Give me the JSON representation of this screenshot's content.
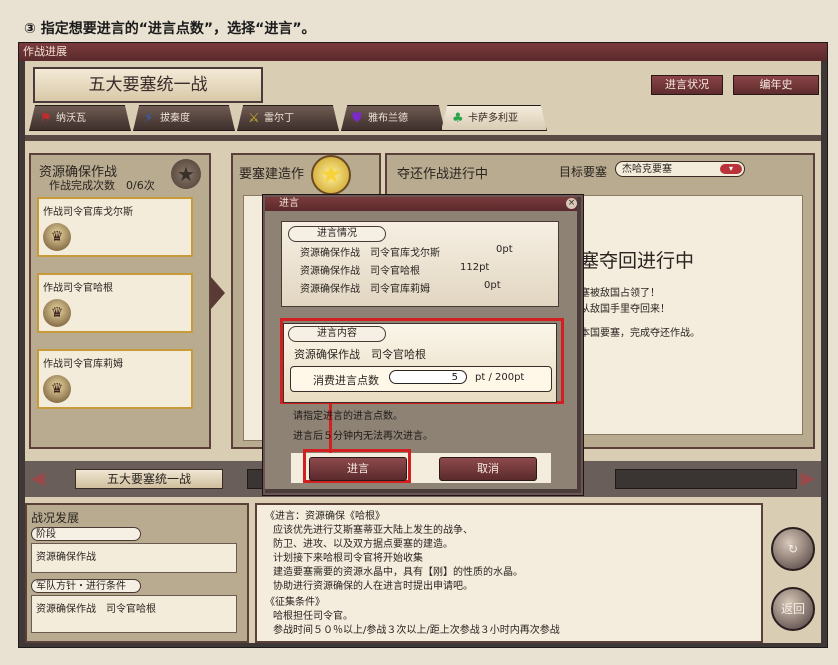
{
  "caption": "③ 指定想要进言的“进言点数”，选择“进言”。",
  "window": {
    "title": "作战进展"
  },
  "header": {
    "main_title": "五大要塞统一战",
    "btn_status": "进言状况",
    "btn_history": "编年史"
  },
  "tabs": [
    {
      "label": "纳沃瓦",
      "icon": "banner-icon",
      "glyph": "⚑",
      "color": "#c62a2a"
    },
    {
      "label": "拔秦度",
      "icon": "lightning-icon",
      "glyph": "⚡",
      "color": "#2a62c6"
    },
    {
      "label": "雷尔丁",
      "icon": "sword-icon",
      "glyph": "⚔",
      "color": "#c8b02a"
    },
    {
      "label": "雅布兰德",
      "icon": "shield-icon",
      "glyph": "⛊",
      "color": "#7a2ac6"
    },
    {
      "label": "卡萨多利亚",
      "icon": "clover-icon",
      "glyph": "♣",
      "color": "#2aa24a"
    }
  ],
  "left_panel": {
    "title": "资源确保作战",
    "sub": "作战完成次数　0/6次",
    "cards": [
      {
        "label": "作战司令官库戈尔斯"
      },
      {
        "label": "作战司令官哈根"
      },
      {
        "label": "作战司令官库莉姆"
      }
    ]
  },
  "mid_panel": {
    "title": "要塞建造作"
  },
  "right_panel": {
    "title": "夺还作战进行中",
    "target_label": "目标要塞",
    "target_value": "杰哈克要塞",
    "banner": "塞夺回进行中",
    "line1": "塞被敌国占领了！",
    "line2": "从敌国手里夺回来！",
    "line3": "本国要塞，完成夺还作战。"
  },
  "navbar": {
    "label": "五大要塞统一战"
  },
  "lower_left": {
    "title": "战况发展",
    "stage_label": "阶段",
    "stage_value": "资源确保作战",
    "policy_label": "军队方针・进行条件",
    "policy_value": "资源确保作战　司令官哈根"
  },
  "lower_main": {
    "lines": [
      "《进言：资源确保《哈根》",
      "应该优先进行艾斯塞蒂亚大陆上发生的战争、",
      "防卫、进攻、以及双方据点要塞的建造。",
      "计划接下来哈根司令官将开始收集",
      "建造要塞需要的资源水晶中，具有【刚】的性质的水晶。",
      "协助进行资源确保的人在进言时提出申请吧。",
      "《征集条件》",
      "哈根担任司令官。",
      "参战时间５０％以上/参战３次以上/距上次参战３小时内再次参战"
    ],
    "round_btn_1": "↻",
    "round_btn_2": "返回"
  },
  "dialog": {
    "title": "进言",
    "close": "×",
    "situation_label": "进言情况",
    "situation_rows": [
      {
        "name": "资源确保作战　司令官库戈尔斯",
        "pts": "0pt"
      },
      {
        "name": "资源确保作战　司令官哈根",
        "pts": "112pt"
      },
      {
        "name": "资源确保作战　司令官库莉姆",
        "pts": "0pt"
      }
    ],
    "content_label": "进言内容",
    "content_text": "资源确保作战　司令官哈根",
    "consume_label": "消费进言点数",
    "points_value": "5",
    "points_unit": "pt / 200pt",
    "hint1": "请指定进言的进言点数。",
    "hint2": "进言后５分钟内无法再次进言。",
    "btn_submit": "进言",
    "btn_cancel": "取消"
  }
}
